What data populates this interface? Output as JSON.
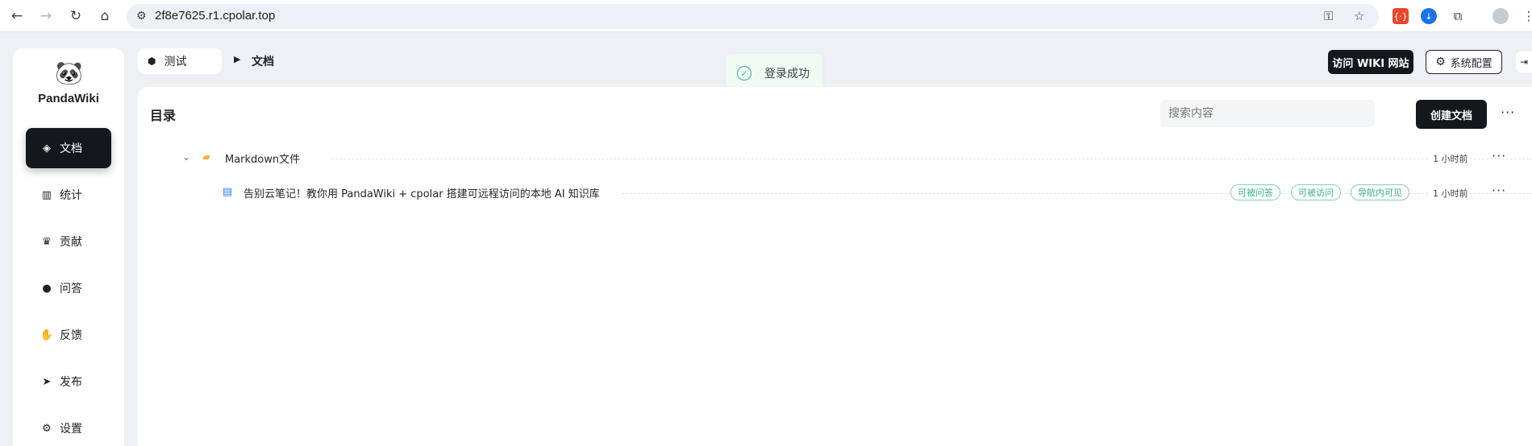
{
  "browser": {
    "url": "2f8e7625.r1.cpolar.top",
    "back_icon": "arrow-left-icon",
    "forward_icon": "arrow-right-icon",
    "reload_icon": "reload-icon",
    "home_icon": "home-icon"
  },
  "sidebar": {
    "brand": "PandaWiki",
    "items": [
      {
        "label": "文档",
        "icon": "layers-icon",
        "active": true
      },
      {
        "label": "统计",
        "icon": "bar-chart-icon"
      },
      {
        "label": "贡献",
        "icon": "trophy-icon"
      },
      {
        "label": "问答",
        "icon": "chat-icon"
      },
      {
        "label": "反馈",
        "icon": "hand-icon"
      },
      {
        "label": "发布",
        "icon": "send-icon"
      },
      {
        "label": "设置",
        "icon": "gear-icon"
      }
    ]
  },
  "header": {
    "kb_name": "测试",
    "current": "文档",
    "visit_wiki": "访问 WIKI 网站",
    "system_config": "系统配置"
  },
  "toast": {
    "text": "登录成功",
    "type": "success"
  },
  "main": {
    "title": "目录",
    "search_placeholder": "搜索内容",
    "create_button": "创建文档",
    "tree": [
      {
        "type": "folder",
        "name": "Markdown文件",
        "time": "1 小时前"
      },
      {
        "type": "doc",
        "name": "告别云笔记！教你用 PandaWiki + cpolar 搭建可远程访问的本地 AI 知识库",
        "time": "1 小时前",
        "tags": [
          "可被问答",
          "可被访问",
          "导航内可见"
        ]
      }
    ]
  },
  "colors": {
    "accent_dark": "#14171c",
    "success": "#36b37e",
    "folder": "#f2b53a",
    "doc": "#2f7fff"
  }
}
